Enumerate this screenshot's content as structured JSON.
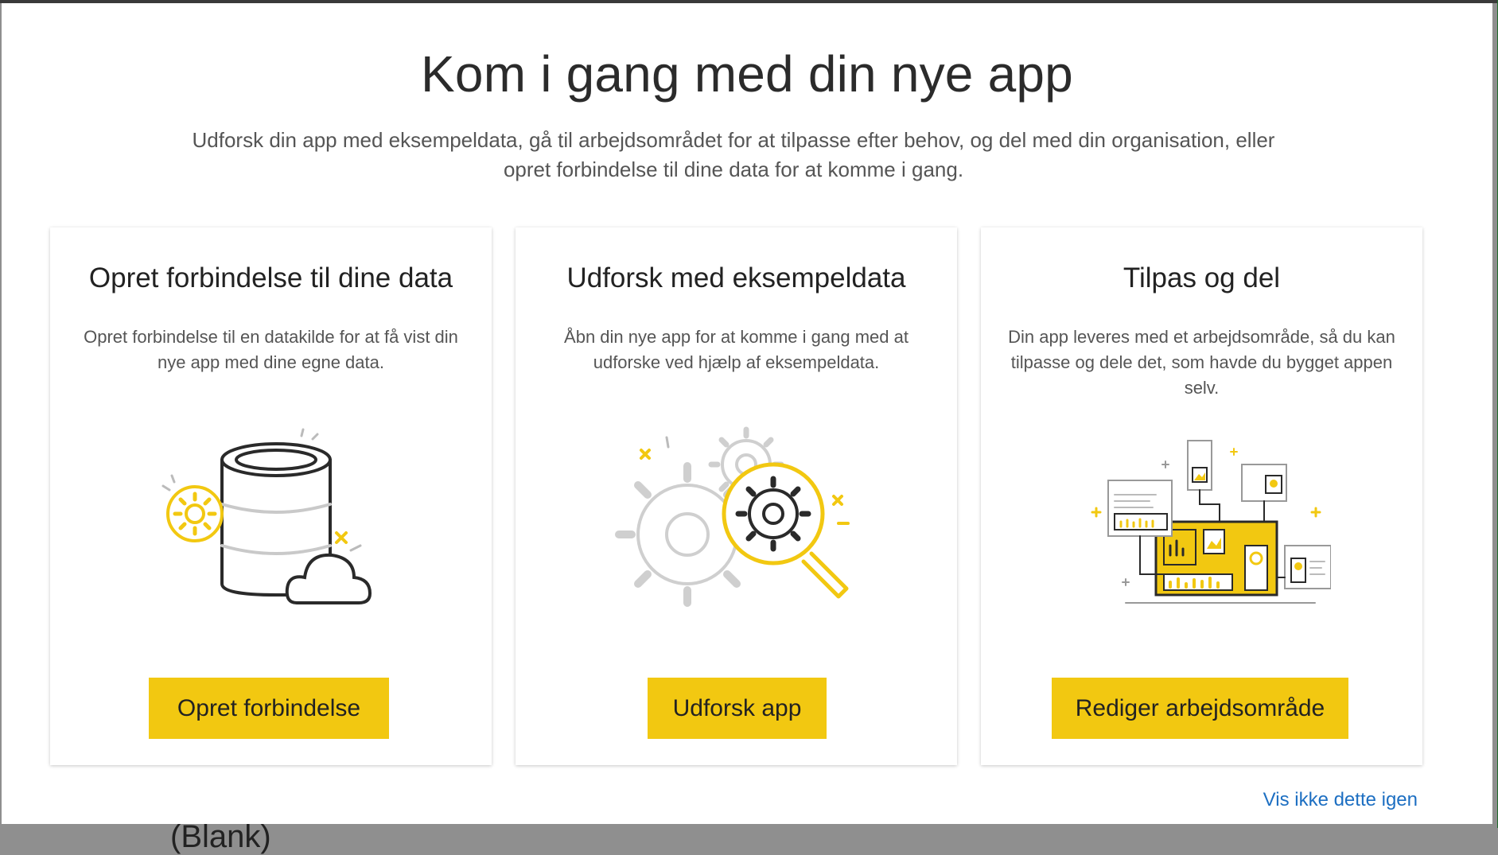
{
  "dialog": {
    "title": "Kom i gang med din nye app",
    "subtitle": "Udforsk din app med eksempeldata, gå til arbejdsområdet for at tilpasse efter behov, og del med din organisation, eller opret forbindelse til dine data for at komme i gang."
  },
  "cards": [
    {
      "title": "Opret forbindelse til dine data",
      "description": "Opret forbindelse til en datakilde for at få vist din nye app med dine egne data.",
      "button": "Opret forbindelse",
      "icon": "database-cloud-icon"
    },
    {
      "title": "Udforsk med eksempeldata",
      "description": "Åbn din nye app for at komme i gang med at udforske ved hjælp af eksempeldata.",
      "button": "Udforsk app",
      "icon": "gears-magnifier-icon"
    },
    {
      "title": "Tilpas og del",
      "description": "Din app leveres med et arbejdsområde, så du kan tilpasse og dele det, som havde du bygget appen selv.",
      "button": "Rediger arbejdsområde",
      "icon": "dashboard-network-icon"
    }
  ],
  "footer": {
    "dismiss_link": "Vis ikke dette igen"
  },
  "background": {
    "partial_text": "(Blank)"
  },
  "colors": {
    "accent": "#f2c811",
    "link": "#1d6fc2",
    "title_text": "#2b2b2b",
    "body_text": "#555555"
  }
}
